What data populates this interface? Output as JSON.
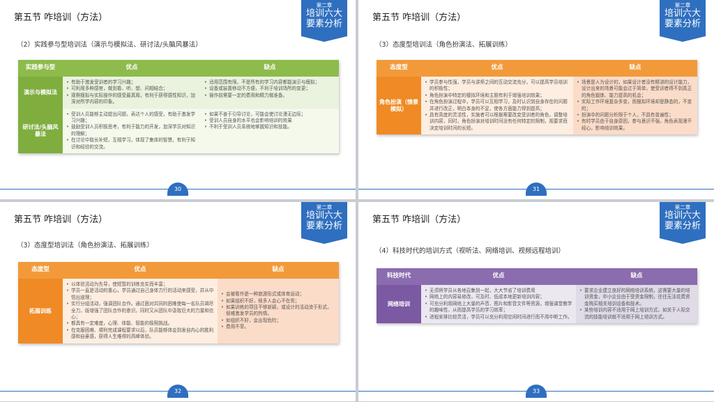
{
  "slides": [
    {
      "section": "第五节  咋培训（方法）",
      "badge_chapter": "第二章",
      "badge_line1": "培训六大",
      "badge_line2": "要素分析",
      "subtitle": "（2）实践参与型培训法（演示与模拟法、研讨法/头脑风暴法）",
      "head": [
        "实践参与型",
        "优点",
        "缺点"
      ],
      "rows": [
        {
          "label": "演示与模拟法",
          "pros": [
            "有助于激发受训者的学习兴趣；",
            "可利用多种感官，做到看、听、想、问相结合；",
            "观察模拟与实际操作的感受最真观，有利于获得感性知识，加深对所学内容的印象。"
          ],
          "cons": [
            "适用范围有限，不是所有的学习内容都能演示与模拟；",
            "设备或装置移动不方便，不利于培训场所的变更；",
            "操作前需要一定的费用和精力做准备。"
          ]
        },
        {
          "label": "研讨法/头脑风暴法",
          "pros": [
            "受训人员能够主动提出问题，表达个人的感受，有助于激发学习兴趣；",
            "鼓励受训人员积极思考，有利于能力的开发，加深学员对知识的理解；",
            "在讨论中取长补短，互相学习，体现了集体的智慧，有利于知识和经验的交流。"
          ],
          "cons": [
            "如果不善于引导讨论，可能会使讨论漫无边际；",
            "受训人员自身的水平也会影响培训的效果",
            "不利于受训人员系统地掌握知识和技能。"
          ]
        }
      ],
      "page": "30"
    },
    {
      "section": "第五节  咋培训（方法）",
      "badge_chapter": "第二章",
      "badge_line1": "培训六大",
      "badge_line2": "要素分析",
      "subtitle": "（3）态度型培训法（角色扮演法、拓展训练）",
      "head": [
        "态度型",
        "优点",
        "缺点"
      ],
      "rows": [
        {
          "label": "角色扮演（情景模拟）",
          "pros": [
            "学员参与性强，学员与讲师之间的互动交流充分，可以提高学员培训的积极性；",
            "角色扮演中特定的模拟环境和主题有利于增强培训效果；",
            "在角色扮演过程中，学员可以互相学习，及时认识到自身存在的问题并进行改正，明白本身的不足，使各方面能力得到提高；",
            "具有高度的灵活性，实施者可以根据需要改变受训者的角色，调整培训内容，同时，角色扮演对培训时间没有任何特定的限制，视要求而决定培训时间的长短。"
          ],
          "cons": [
            "场景是人为设计的，如果设计者没有精湛的设计能力，设计出来的场景可能会过于简单，使受训者得不到真正的角色锻炼、能力提高的机会；",
            "实际工作环境复杂多变，而模拟环境却是静态的，不变的；",
            "扮演中的问题分析限于个人，不具有普遍性；",
            "有时学员由于自身原因，参与意识不强，角色表现漫不经心，影响培训效果。"
          ]
        }
      ],
      "page": "31"
    },
    {
      "section": "第五节  咋培训（方法）",
      "badge_chapter": "第二章",
      "badge_line1": "培训六大",
      "badge_line2": "要素分析",
      "subtitle": "（3）态度型培训法（角色扮演法、拓展训练）",
      "head": [
        "态度型",
        "优点",
        "缺点"
      ],
      "rows": [
        {
          "label": "拓展训练",
          "pros": [
            "以体验活动为先导，使短暂的训练充实而丰富；",
            "学员一直是活动的重心，学员通过自己身体力行的活动来感受，并从中悟出道理；",
            "实行分组活动，强调团队合作。通过面对共同的困难使每一名队员竭尽全力，既增强了团队合作的意识，同时又从团队中汲取巨大的力量和信心；",
            "都具有一定难度，心理、体能、智能的极限挑战。",
            "在克服困难、顺利完成课程要求以后，队员能够体会到发自内心的胜利感和自豪感，获得人生难得的高峰体验。"
          ],
          "cons": [
            "会被看作是一种旅游形式或体育运动；",
            "如果组织不好，很多人会心不在焉；",
            "如果训练的项目不够新颖，或设计的活动流于形式，很难激发学员的热情。",
            "如组织不好，会出现危险；",
            "费用不菲。"
          ]
        }
      ],
      "page": "32"
    },
    {
      "section": "第五节  咋培训（方法）",
      "badge_chapter": "第二章",
      "badge_line1": "培训六大",
      "badge_line2": "要素分析",
      "subtitle": "（4）科技时代的培训方式（视听法、网络培训、视频远程培训）",
      "head": [
        "科技时代",
        "优点",
        "缺点"
      ],
      "rows": [
        {
          "label": "网络培训",
          "pros": [
            "无须将学员从各地召集到一起，大大节省了培训费用",
            "网络上的内容易修改，可及时、低成本地更新培训内容；",
            "可充分利用网络上大量的声音、图片和影音文件等资源，增强课堂教学的趣味性，从而提高学员的学习效率；",
            "进程安排比较灵活，学员可以充分利用空闲时间进行而不用中断工作。"
          ],
          "cons": [
            "要求企业建立良好的网络培训系统，这需要大量的培训资金，中小企业由于受资金限制，往往无法花费资金购买相关培训设备和技术。",
            "某些培训内容不适用于网上培训方式，如关于人际交流的技能培训就不适用于网上培训方式。"
          ]
        }
      ],
      "page": "33"
    }
  ],
  "colors": {
    "blue": "#2f6fbf",
    "green": "#8dbb4c",
    "orange": "#f29a3a",
    "purple": "#8b6cae"
  }
}
